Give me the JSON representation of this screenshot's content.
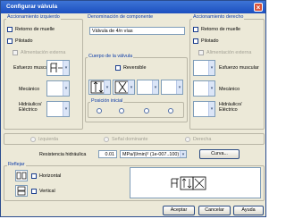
{
  "window": {
    "title": "Configurar válvula"
  },
  "left_group": {
    "title": "Accionamiento izquierdo",
    "retorno": "Retorno de muelle",
    "pilotado": "Pilotado",
    "alimentacion": "Alimentación externa",
    "esfuerzo": "Esfuerzo muscular",
    "mecanico": "Mecánico",
    "hidraulico": "Hidráulico/ Eléctrico"
  },
  "center": {
    "title": "Denominación de componente",
    "name_value": "Válvula de 4/n vías",
    "body_title": "Cuerpo de la válvula",
    "reversible": "Reversible",
    "initial_title": "Posición inicial"
  },
  "right_group": {
    "title": "Accionamiento derecho",
    "retorno": "Retorno de muelle",
    "pilotado": "Pilotado",
    "alimentacion": "Alimentación externa",
    "esfuerzo": "Esfuerzo muscular",
    "mecanico": "Mecánico",
    "hidraulico": "Hidráulico/ Eléctrico"
  },
  "position_row": {
    "izquierda": "Izquierda",
    "dominante": "Señal dominante",
    "derecha": "Derecha"
  },
  "resistance": {
    "label": "Resistencia hidráulica",
    "value": "0.01",
    "unit": "MPa/(l/min)² (1e-007..100)",
    "curve": "Curva..."
  },
  "reflect": {
    "title": "Reflejar",
    "horizontal": "Horizontal",
    "vertical": "Vertical"
  },
  "buttons": {
    "accept": "Aceptar",
    "cancel": "Cancelar",
    "help": "Ayuda"
  },
  "icons": {
    "close": "close-icon",
    "dropdown": "chevron-down-icon"
  }
}
